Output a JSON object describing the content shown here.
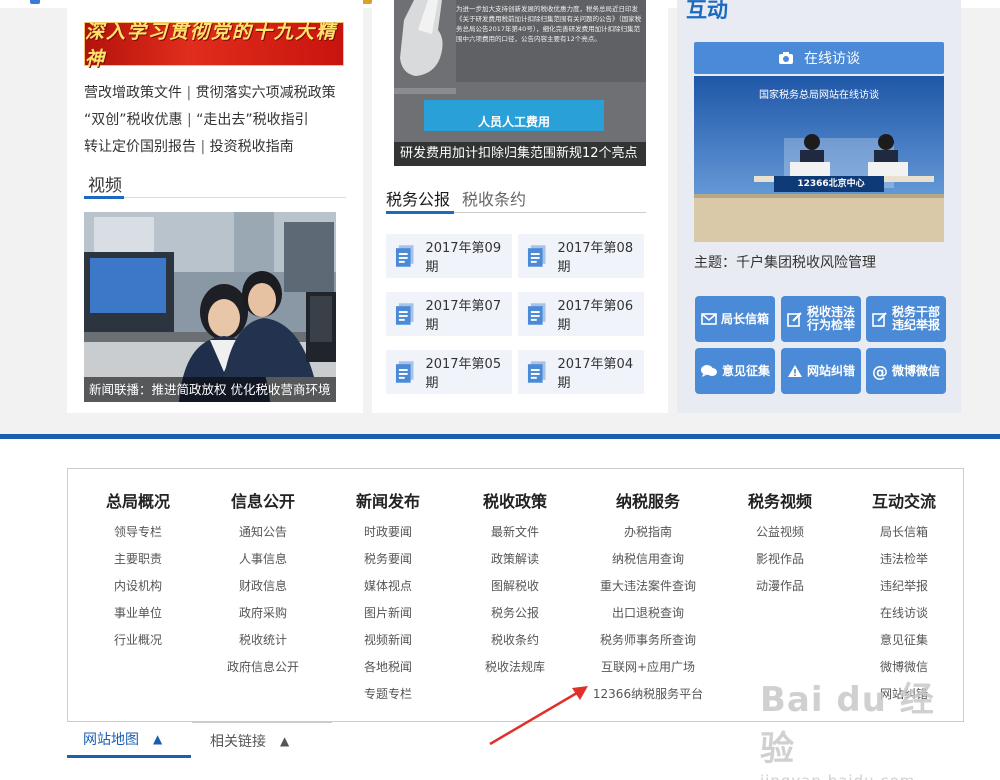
{
  "banner_text": "深入学习贯彻党的十九大精神",
  "policy_links": [
    {
      "text": "营改增政策文件"
    },
    {
      "text": "贯彻落实六项减税政策"
    },
    {
      "text": "“双创”税收优惠"
    },
    {
      "text": "“走出去”税收指引"
    },
    {
      "text": "转让定价国别报告"
    },
    {
      "text": "投资税收指南"
    }
  ],
  "separator": "|",
  "video": {
    "title": "视频",
    "caption": "新闻联播：推进简政放权 优化税收营商环境"
  },
  "rd_news": {
    "caption": "研发费用加计扣除归集范围新规12个亮点",
    "ribbon": "人员人工费用",
    "doc_text": "为进一步加大支持创新发展的税收优惠力度，税务总局近日印发《关于研发费用税前加计扣除归集范围有关问题的公告》（国家税务总局公告2017年第40号），细化完善研发费用加计扣除归集范围中六项费用的口径，公告内容主要有12个亮点。"
  },
  "tax_tabs": {
    "active": "税务公报",
    "other": "税收条约"
  },
  "issues": [
    "2017年第09期",
    "2017年第08期",
    "2017年第07期",
    "2017年第06期",
    "2017年第05期",
    "2017年第04期"
  ],
  "interaction": {
    "title": "互动",
    "online_button": "在线访谈",
    "studio_header": "国家税务总局网站在线访谈",
    "studio_logo": "12366北京中心",
    "topic": "主题：千户集团税收风险管理",
    "buttons": [
      {
        "label1": "局长信箱",
        "label2": "",
        "icon": "mail-icon"
      },
      {
        "label1": "税收违法",
        "label2": "行为检举",
        "icon": "edit-icon"
      },
      {
        "label1": "税务干部",
        "label2": "违纪举报",
        "icon": "edit-icon"
      },
      {
        "label1": "意见征集",
        "label2": "",
        "icon": "chat-icon"
      },
      {
        "label1": "网站纠错",
        "label2": "",
        "icon": "warning-icon"
      },
      {
        "label1": "微博微信",
        "label2": "",
        "icon": "at-icon"
      }
    ]
  },
  "sitemap": [
    {
      "head": "总局概况",
      "items": [
        "领导专栏",
        "主要职责",
        "内设机构",
        "事业单位",
        "行业概况"
      ]
    },
    {
      "head": "信息公开",
      "items": [
        "通知公告",
        "人事信息",
        "财政信息",
        "政府采购",
        "税收统计",
        "政府信息公开"
      ]
    },
    {
      "head": "新闻发布",
      "items": [
        "时政要闻",
        "税务要闻",
        "媒体视点",
        "图片新闻",
        "视频新闻",
        "各地税闻",
        "专题专栏"
      ]
    },
    {
      "head": "税收政策",
      "items": [
        "最新文件",
        "政策解读",
        "图解税收",
        "税务公报",
        "税收条约",
        "税收法规库"
      ]
    },
    {
      "head": "纳税服务",
      "items": [
        "办税指南",
        "纳税信用查询",
        "重大违法案件查询",
        "出口退税查询",
        "税务师事务所查询",
        "互联网+应用广场",
        "12366纳税服务平台"
      ]
    },
    {
      "head": "税务视频",
      "items": [
        "公益视频",
        "影视作品",
        "动漫作品"
      ]
    },
    {
      "head": "互动交流",
      "items": [
        "局长信箱",
        "违法检举",
        "违纪举报",
        "在线访谈",
        "意见征集",
        "微博微信",
        "网站纠错"
      ]
    }
  ],
  "footer_tabs": {
    "sitemap": "网站地图",
    "links": "相关链接",
    "arrow": "▲"
  },
  "watermark": {
    "main": "Bai du 经验",
    "sub": "jingyan.baidu.com"
  },
  "colors": {
    "accent": "#1a5fb0",
    "button": "#4b8ad6",
    "arrow": "#e0302a"
  }
}
